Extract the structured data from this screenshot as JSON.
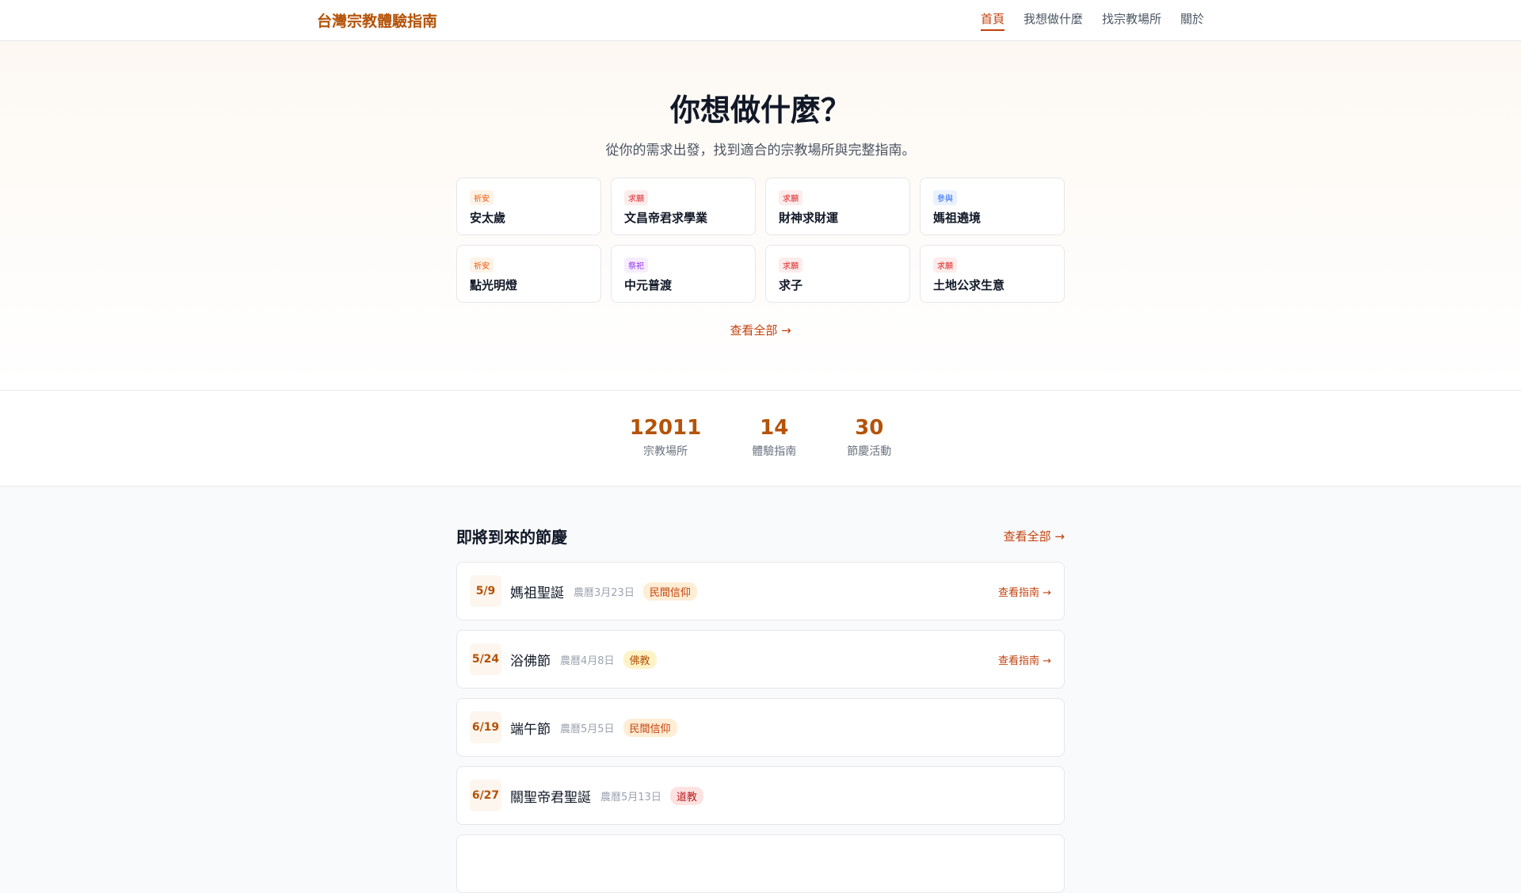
{
  "header": {
    "logo": "台灣宗教體驗指南",
    "nav": [
      "首頁",
      "我想做什麼",
      "找宗教場所",
      "關於"
    ]
  },
  "hero": {
    "title": "你想做什麼？",
    "subtitle": "從你的需求出發，找到適合的宗教場所與完整指南。",
    "more": "查看全部 →",
    "cards": [
      {
        "tag": "祈安",
        "title": "安太歲",
        "color": "orange"
      },
      {
        "tag": "求願",
        "title": "文昌帝君求學業",
        "color": "red"
      },
      {
        "tag": "求願",
        "title": "財神求財運",
        "color": "red"
      },
      {
        "tag": "參與",
        "title": "媽祖遶境",
        "color": "blue"
      },
      {
        "tag": "祈安",
        "title": "點光明燈",
        "color": "orange"
      },
      {
        "tag": "祭祀",
        "title": "中元普渡",
        "color": "purple"
      },
      {
        "tag": "求願",
        "title": "求子",
        "color": "red"
      },
      {
        "tag": "求願",
        "title": "土地公求生意",
        "color": "red"
      }
    ]
  },
  "stats": [
    {
      "value": "12011",
      "label": "宗教場所"
    },
    {
      "value": "14",
      "label": "體驗指南"
    },
    {
      "value": "30",
      "label": "節慶活動"
    }
  ],
  "festivals": {
    "title": "即將到來的節慶",
    "more": "查看全部 →",
    "items": [
      {
        "date": "5/9",
        "name": "媽祖聖誕",
        "lunar": "農曆3月23日",
        "badge": "民間信仰",
        "type": "folk",
        "guide": "查看指南 →"
      },
      {
        "date": "5/24",
        "name": "浴佛節",
        "lunar": "農曆4月8日",
        "badge": "佛教",
        "type": "bud",
        "guide": "查看指南 →"
      },
      {
        "date": "6/19",
        "name": "端午節",
        "lunar": "農曆5月5日",
        "badge": "民間信仰",
        "type": "folk"
      },
      {
        "date": "6/27",
        "name": "關聖帝君聖誕",
        "lunar": "農曆5月13日",
        "badge": "道教",
        "type": "tao"
      },
      {}
    ]
  }
}
